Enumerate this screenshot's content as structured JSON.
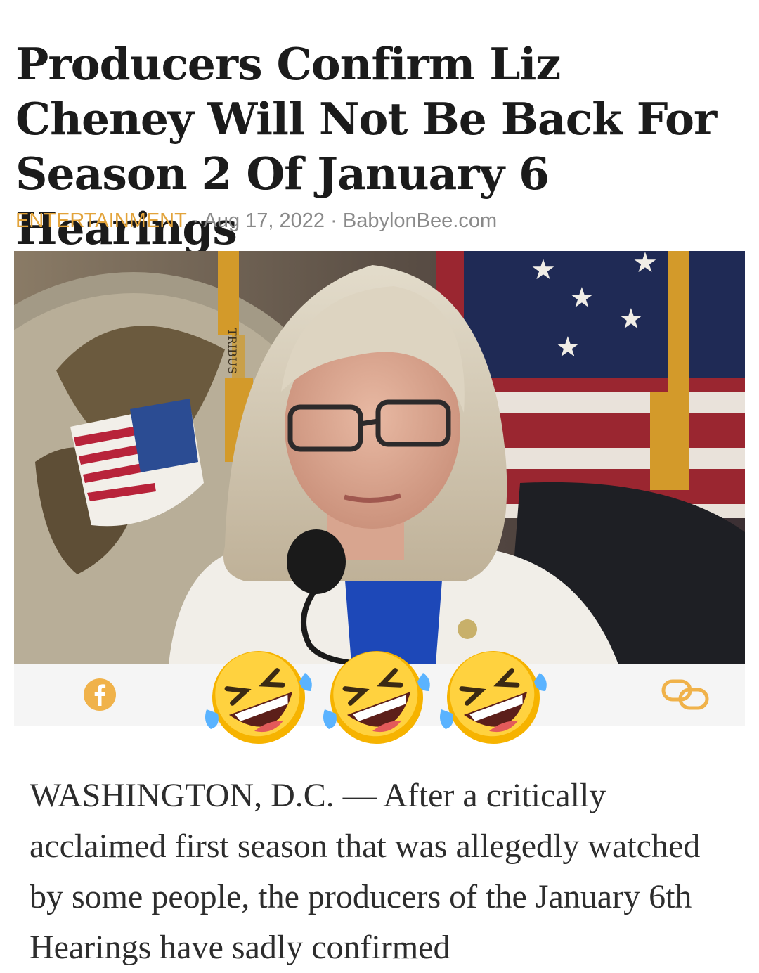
{
  "article": {
    "headline": "Producers Confirm Liz Cheney Will Not Be Back For Season 2 Of January 6 Hearings",
    "category": "ENTERTAINMENT",
    "separator": "·",
    "date": "Aug 17, 2022",
    "source": "BabylonBee.com",
    "body": "WASHINGTON, D.C. — After a critically acclaimed first season that was allegedly watched by some people, the producers of the January 6th Hearings have sadly confirmed"
  },
  "photo": {
    "seal_text": "TRIBUS"
  },
  "share_bar": {
    "left_icon": "facebook-icon",
    "right_icon": "link-icon"
  },
  "overlay": {
    "emoji": [
      "rolling-on-floor-laughing",
      "rolling-on-floor-laughing",
      "rolling-on-floor-laughing"
    ]
  },
  "colors": {
    "category": "#e2a33a",
    "meta_text": "#8a8a8a",
    "headline": "#1b1b1b",
    "share_icon": "#f0b24a"
  }
}
